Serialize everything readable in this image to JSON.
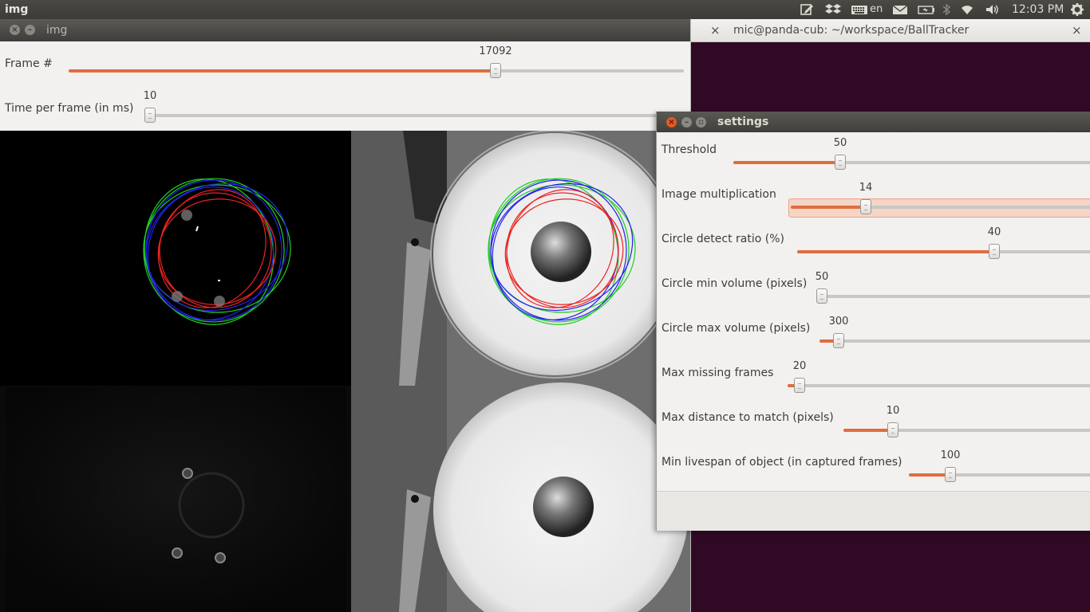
{
  "topbar": {
    "app_title": "img",
    "keyboard_layout": "en",
    "clock": "12:03 PM"
  },
  "terminal": {
    "title": "mic@panda-cub: ~/workspace/BallTracker",
    "close_label": "×"
  },
  "img_window": {
    "title": "img",
    "trackbars": [
      {
        "label": "Frame #",
        "value": "17092",
        "fraction": 0.694
      },
      {
        "label": "Time per frame (in ms)",
        "value": "10",
        "fraction": 0.01
      }
    ]
  },
  "settings_window": {
    "title": "settings",
    "trackbars": [
      {
        "label": "Threshold",
        "value": "50",
        "fraction": 0.3
      },
      {
        "label": "Image multiplication",
        "value": "14",
        "fraction": 0.25
      },
      {
        "label": "Circle detect ratio (%)",
        "value": "40",
        "fraction": 0.67
      },
      {
        "label": "Circle min volume (pixels)",
        "value": "50",
        "fraction": 0.005
      },
      {
        "label": "Circle max volume (pixels)",
        "value": "300",
        "fraction": 0.07
      },
      {
        "label": "Max missing frames",
        "value": "20",
        "fraction": 0.04
      },
      {
        "label": "Max distance to match (pixels)",
        "value": "10",
        "fraction": 0.2
      },
      {
        "label": "Min livespan of object (in captured frames)",
        "value": "100",
        "fraction": 0.23
      }
    ]
  },
  "colors": {
    "accent": "#e06d3e",
    "terminal_bg": "#300a24",
    "panel_bg": "#3c3b37",
    "window_bg": "#f2f1f0"
  },
  "icons": [
    "edit-icon",
    "dropbox-icon",
    "keyboard-icon",
    "mail-icon",
    "battery-icon",
    "bluetooth-icon",
    "wifi-icon",
    "volume-icon",
    "gear-icon"
  ]
}
